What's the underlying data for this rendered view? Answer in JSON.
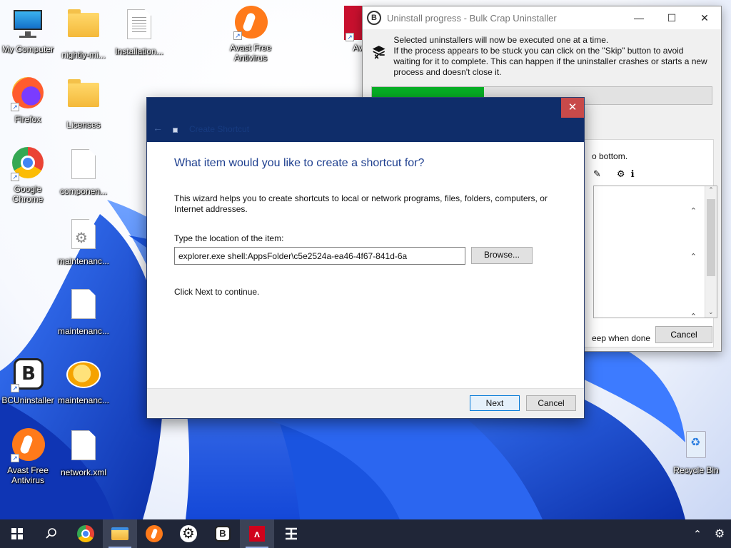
{
  "desktop": {
    "icons": [
      {
        "label": "My Computer"
      },
      {
        "label": "nightly-mi..."
      },
      {
        "label": "Installation..."
      },
      {
        "label": "Avast Free Antivirus"
      },
      {
        "label": "Firefox"
      },
      {
        "label": "Licenses"
      },
      {
        "label": "Google Chrome"
      },
      {
        "label": "componen..."
      },
      {
        "label": "maintenanc..."
      },
      {
        "label": "maintenanc..."
      },
      {
        "label": "BCUninstaller"
      },
      {
        "label": "maintenanc..."
      },
      {
        "label": "Avast Free Antivirus"
      },
      {
        "label": "network.xml"
      },
      {
        "label": "Recycle Bin"
      },
      {
        "label": "Av"
      }
    ]
  },
  "bcu_window": {
    "title": "Uninstall progress - Bulk Crap Uninstaller",
    "minimize": "—",
    "maximize": "☐",
    "close": "✕",
    "message_line1": "Selected uninstallers will now be executed one at a time.",
    "message_line2": "If the process appears to be stuck you can click on the \"Skip\" button to avoid waiting for it to complete. This can happen if the uninstaller crashes or starts a new process and doesn't close it.",
    "progress_fraction": 0.33,
    "panel_text": "o bottom.",
    "keep_text": "eep when done",
    "cancel_label": "Cancel",
    "accent_color": "#06b025"
  },
  "wizard": {
    "title": "Create Shortcut",
    "close": "✕",
    "back": "←",
    "heading": "What item would you like to create a shortcut for?",
    "description": "This wizard helps you to create shortcuts to local or network programs, files, folders, computers, or Internet addresses.",
    "location_label": "Type the location of the item:",
    "location_value": "explorer.exe shell:AppsFolder\\c5e2524a-ea46-4f67-841d-6a",
    "browse_label": "Browse...",
    "continue_text": "Click Next to continue.",
    "next_label": "Next",
    "cancel_label": "Cancel"
  },
  "taskbar": {
    "items": [
      "start-icon",
      "search-icon",
      "chrome-icon",
      "file-explorer-icon",
      "avast-icon",
      "settings-gear-icon",
      "bcuninstaller-icon",
      "avira-icon",
      "bcu-tool-icon"
    ],
    "tray": [
      "chevron-up-icon",
      "gear-icon"
    ]
  }
}
